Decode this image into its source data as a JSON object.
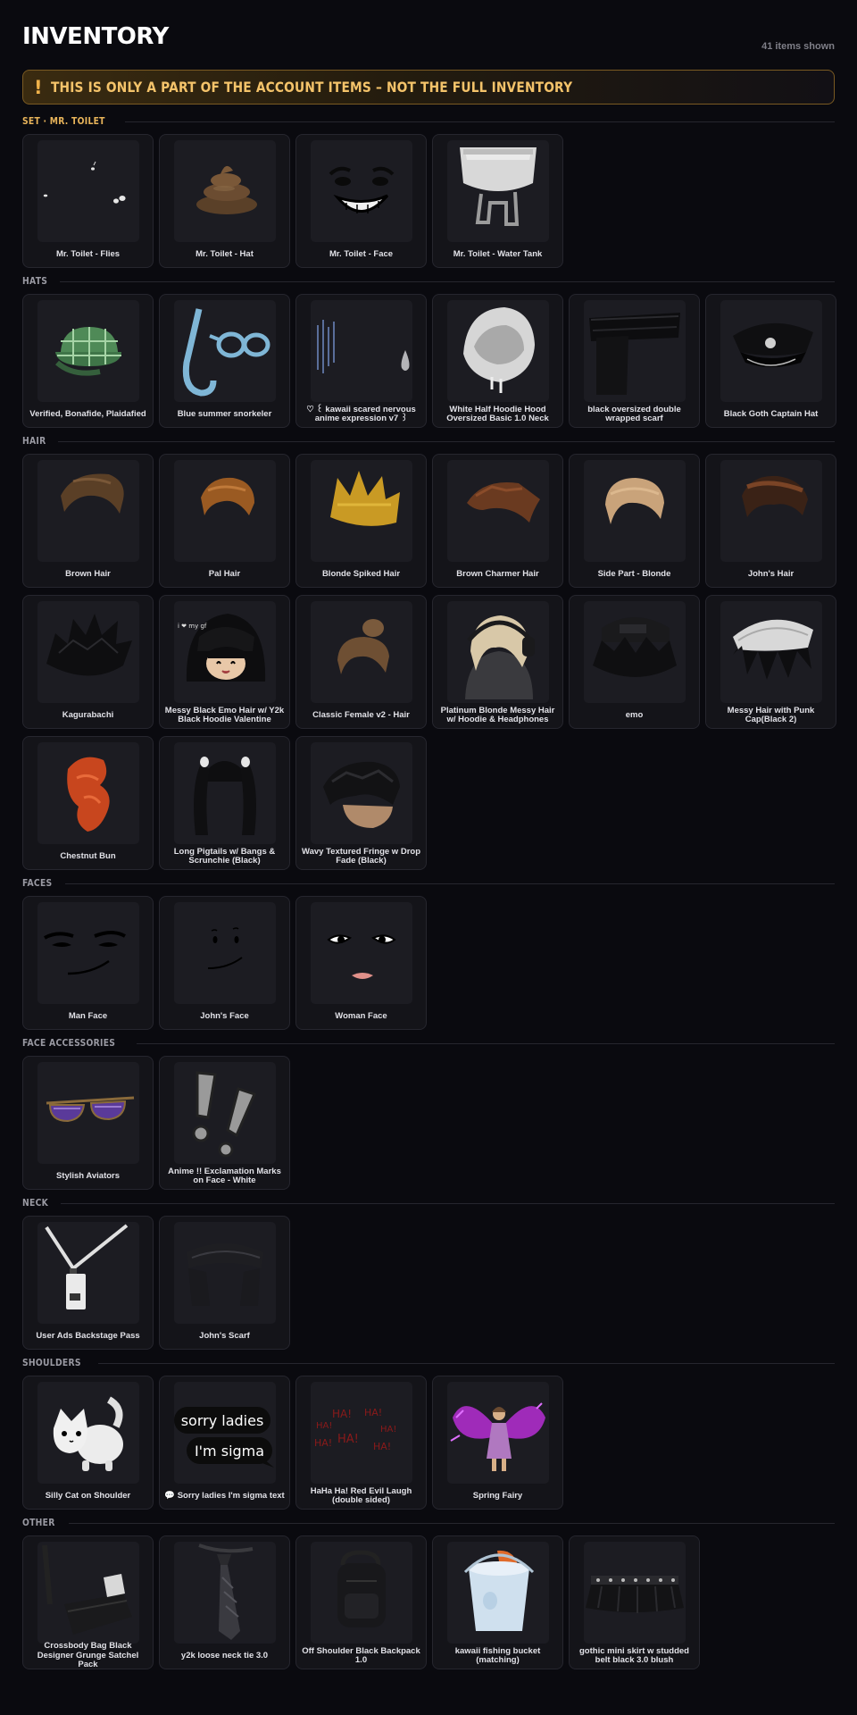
{
  "header": {
    "title": "INVENTORY",
    "count": "41 items shown"
  },
  "warning": {
    "icon": "!",
    "text": "THIS IS ONLY A PART OF THE ACCOUNT ITEMS – NOT THE FULL INVENTORY"
  },
  "colors": {
    "background": "#0a0a0f",
    "card": "#141419",
    "accent_gold": "#f4c36a",
    "warning_border": "#7a5a22"
  },
  "sections": {
    "set": {
      "label": "SET · MR. TOILET",
      "items": [
        {
          "name": "Mr. Toilet - Flies",
          "icon": "flies-icon"
        },
        {
          "name": "Mr. Toilet - Hat",
          "icon": "poop-hat-icon"
        },
        {
          "name": "Mr. Toilet - Face",
          "icon": "grin-face-icon"
        },
        {
          "name": "Mr. Toilet - Water Tank",
          "icon": "water-tank-icon"
        }
      ]
    },
    "hats": {
      "label": "HATS",
      "items": [
        {
          "name": "Verified, Bonafide, Plaidafied",
          "icon": "plaid-cap-icon"
        },
        {
          "name": "Blue summer snorkeler",
          "icon": "snorkel-icon"
        },
        {
          "name": "♡ ꒰ kawaii scared nervous anime expression v7 ꒱",
          "icon": "nervous-expression-icon"
        },
        {
          "name": "White Half Hoodie Hood Oversized Basic 1.0 Neck",
          "icon": "white-hood-icon"
        },
        {
          "name": "black oversized double wrapped scarf",
          "icon": "black-scarf-icon"
        },
        {
          "name": "Black Goth Captain Hat",
          "icon": "captain-hat-icon"
        }
      ]
    },
    "hair": {
      "label": "HAIR",
      "items": [
        {
          "name": "Brown Hair",
          "icon": "hair-icon"
        },
        {
          "name": "Pal Hair",
          "icon": "hair-icon"
        },
        {
          "name": "Blonde Spiked Hair",
          "icon": "hair-icon"
        },
        {
          "name": "Brown Charmer Hair",
          "icon": "hair-icon"
        },
        {
          "name": "Side Part - Blonde",
          "icon": "hair-icon"
        },
        {
          "name": "John's Hair",
          "icon": "hair-icon"
        },
        {
          "name": "Kagurabachi",
          "icon": "hair-icon"
        },
        {
          "name": "Messy Black Emo Hair w/ Y2k Black Hoodie Valentine",
          "icon": "emo-hoodie-icon",
          "tag": "i ❤ my gf"
        },
        {
          "name": "Classic Female v2 - Hair",
          "icon": "hair-bun-icon"
        },
        {
          "name": "Platinum Blonde Messy Hair w/ Hoodie & Headphones",
          "icon": "hair-headphones-icon"
        },
        {
          "name": "emo",
          "icon": "hair-icon"
        },
        {
          "name": "Messy Hair with Punk Cap(Black 2)",
          "icon": "punk-cap-icon"
        },
        {
          "name": "Chestnut Bun",
          "icon": "hair-icon"
        },
        {
          "name": "Long Pigtails w/ Bangs & Scrunchie (Black)",
          "icon": "pigtails-icon"
        },
        {
          "name": "Wavy Textured Fringe w Drop Fade (Black)",
          "icon": "hair-icon"
        }
      ]
    },
    "faces": {
      "label": "FACES",
      "items": [
        {
          "name": "Man Face",
          "icon": "man-face-icon"
        },
        {
          "name": "John's Face",
          "icon": "john-face-icon"
        },
        {
          "name": "Woman Face",
          "icon": "woman-face-icon"
        }
      ]
    },
    "face_accessories": {
      "label": "FACE ACCESSORIES",
      "items": [
        {
          "name": "Stylish Aviators",
          "icon": "aviators-icon"
        },
        {
          "name": "Anime !! Exclamation Marks on Face - White",
          "icon": "exclamation-icon"
        }
      ]
    },
    "neck": {
      "label": "NECK",
      "items": [
        {
          "name": "User Ads Backstage Pass",
          "icon": "lanyard-icon"
        },
        {
          "name": "John's Scarf",
          "icon": "scarf-icon"
        }
      ]
    },
    "shoulders": {
      "label": "SHOULDERS",
      "items": [
        {
          "name": "Silly Cat on Shoulder",
          "icon": "cat-icon"
        },
        {
          "name": "💬 Sorry ladies I'm sigma text",
          "icon": "speech-bubbles-icon",
          "bubble1": "sorry ladies",
          "bubble2": "I'm sigma"
        },
        {
          "name": "HaHa Ha! Red Evil Laugh (double sided)",
          "icon": "laugh-text-icon",
          "laugh": "HA!"
        },
        {
          "name": "Spring Fairy",
          "icon": "fairy-icon"
        }
      ]
    },
    "other": {
      "label": "OTHER",
      "items": [
        {
          "name": "Crossbody Bag Black Designer Grunge Satchel Pack",
          "icon": "bag-icon"
        },
        {
          "name": "y2k loose neck tie 3.0",
          "icon": "tie-icon"
        },
        {
          "name": "Off Shoulder Black Backpack 1.0",
          "icon": "backpack-icon"
        },
        {
          "name": "kawaii fishing bucket (matching)",
          "icon": "bucket-icon"
        },
        {
          "name": "gothic mini skirt w studded belt black 3.0 blush",
          "icon": "skirt-icon"
        }
      ]
    }
  }
}
